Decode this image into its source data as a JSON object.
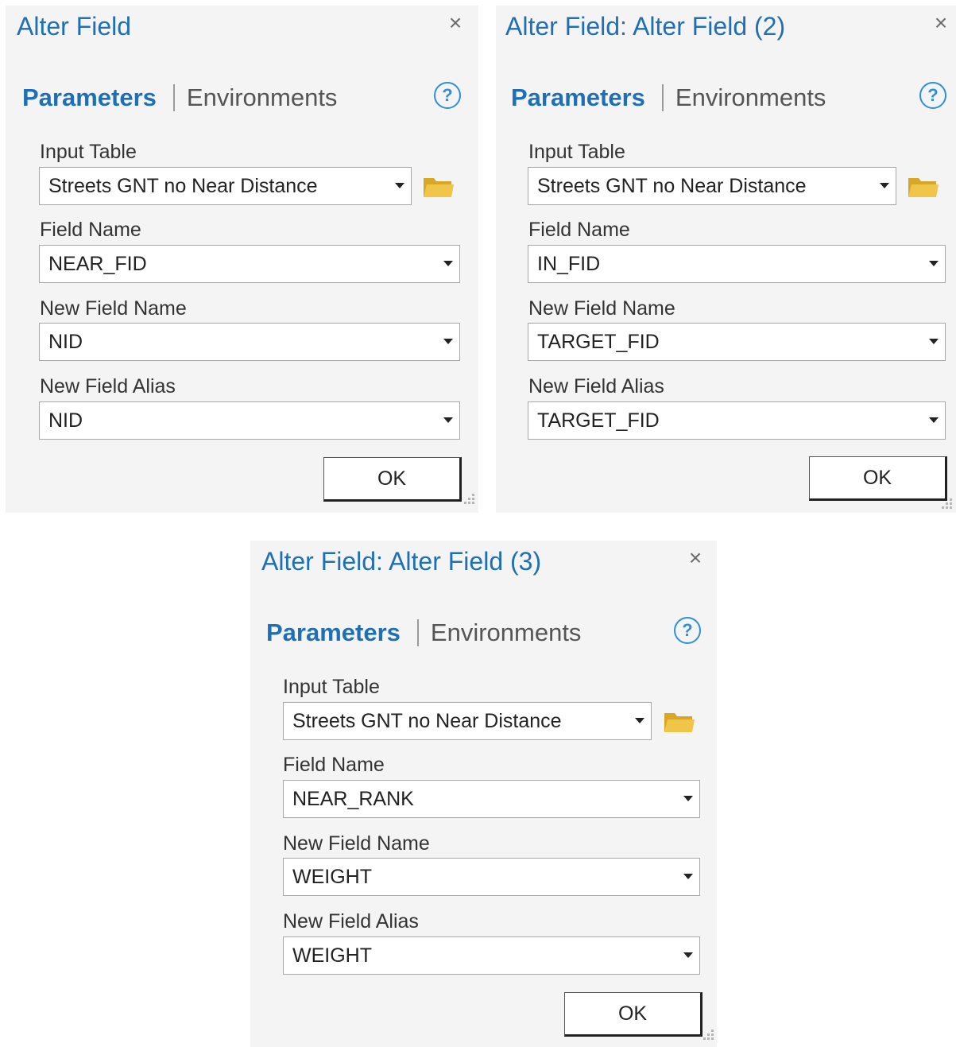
{
  "dialogs": [
    {
      "title": "Alter Field",
      "tabs": {
        "parameters": "Parameters",
        "environments": "Environments"
      },
      "help": "?",
      "close": "×",
      "input_table": {
        "label": "Input Table",
        "value": "Streets GNT no Near Distance"
      },
      "field_name": {
        "label": "Field Name",
        "value": "NEAR_FID"
      },
      "new_field_name": {
        "label": "New Field Name",
        "value": "NID"
      },
      "new_field_alias": {
        "label": "New Field Alias",
        "value": "NID"
      },
      "ok_label": "OK"
    },
    {
      "title": "Alter Field: Alter Field (2)",
      "tabs": {
        "parameters": "Parameters",
        "environments": "Environments"
      },
      "help": "?",
      "close": "×",
      "input_table": {
        "label": "Input Table",
        "value": "Streets GNT no Near Distance"
      },
      "field_name": {
        "label": "Field Name",
        "value": "IN_FID"
      },
      "new_field_name": {
        "label": "New Field Name",
        "value": "TARGET_FID"
      },
      "new_field_alias": {
        "label": "New Field Alias",
        "value": "TARGET_FID"
      },
      "ok_label": "OK"
    },
    {
      "title": "Alter Field: Alter Field (3)",
      "tabs": {
        "parameters": "Parameters",
        "environments": "Environments"
      },
      "help": "?",
      "close": "×",
      "input_table": {
        "label": "Input Table",
        "value": "Streets GNT no Near Distance"
      },
      "field_name": {
        "label": "Field Name",
        "value": "NEAR_RANK"
      },
      "new_field_name": {
        "label": "New Field Name",
        "value": "WEIGHT"
      },
      "new_field_alias": {
        "label": "New Field Alias",
        "value": "WEIGHT"
      },
      "ok_label": "OK"
    }
  ],
  "colors": {
    "accent": "#1f6fb4",
    "help": "#2e8fdc",
    "panel_bg": "#f4f4f4",
    "folder": "#e8b838"
  },
  "icons": {
    "close": "close-icon",
    "help": "help-icon",
    "browse": "folder-icon",
    "dropdown": "chevron-down-icon",
    "resize": "resize-grip-icon"
  }
}
